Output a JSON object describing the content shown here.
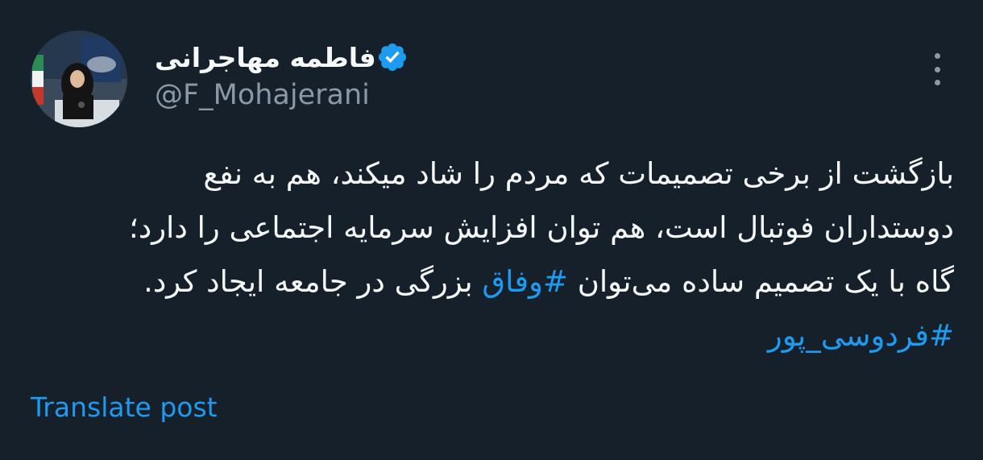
{
  "author": {
    "display_name": "فاطمه مهاجرانی",
    "handle": "@F_Mohajerani",
    "verified": true,
    "avatar_icon": "profile-photo",
    "verified_icon": "verified-badge-icon"
  },
  "post": {
    "line1": "بازگشت از برخی تصمیمات که مردم را شاد میکند، هم به نفع",
    "line2": "دوستداران فوتبال است، هم توان افزایش سرمایه اجتماعی را دارد؛",
    "line3_start": "گاه با یک تصمیم ساده می‌توان ",
    "hashtag1": "#وفاق",
    "line3_end": " بزرگی در جامعه ایجاد کرد.",
    "hashtag2": "#فردوسی_پور"
  },
  "translate_label": "Translate post",
  "colors": {
    "background": "#15202b",
    "text": "#f7f9f9",
    "secondary_text": "#8b98a5",
    "accent": "#1d9bf0"
  }
}
